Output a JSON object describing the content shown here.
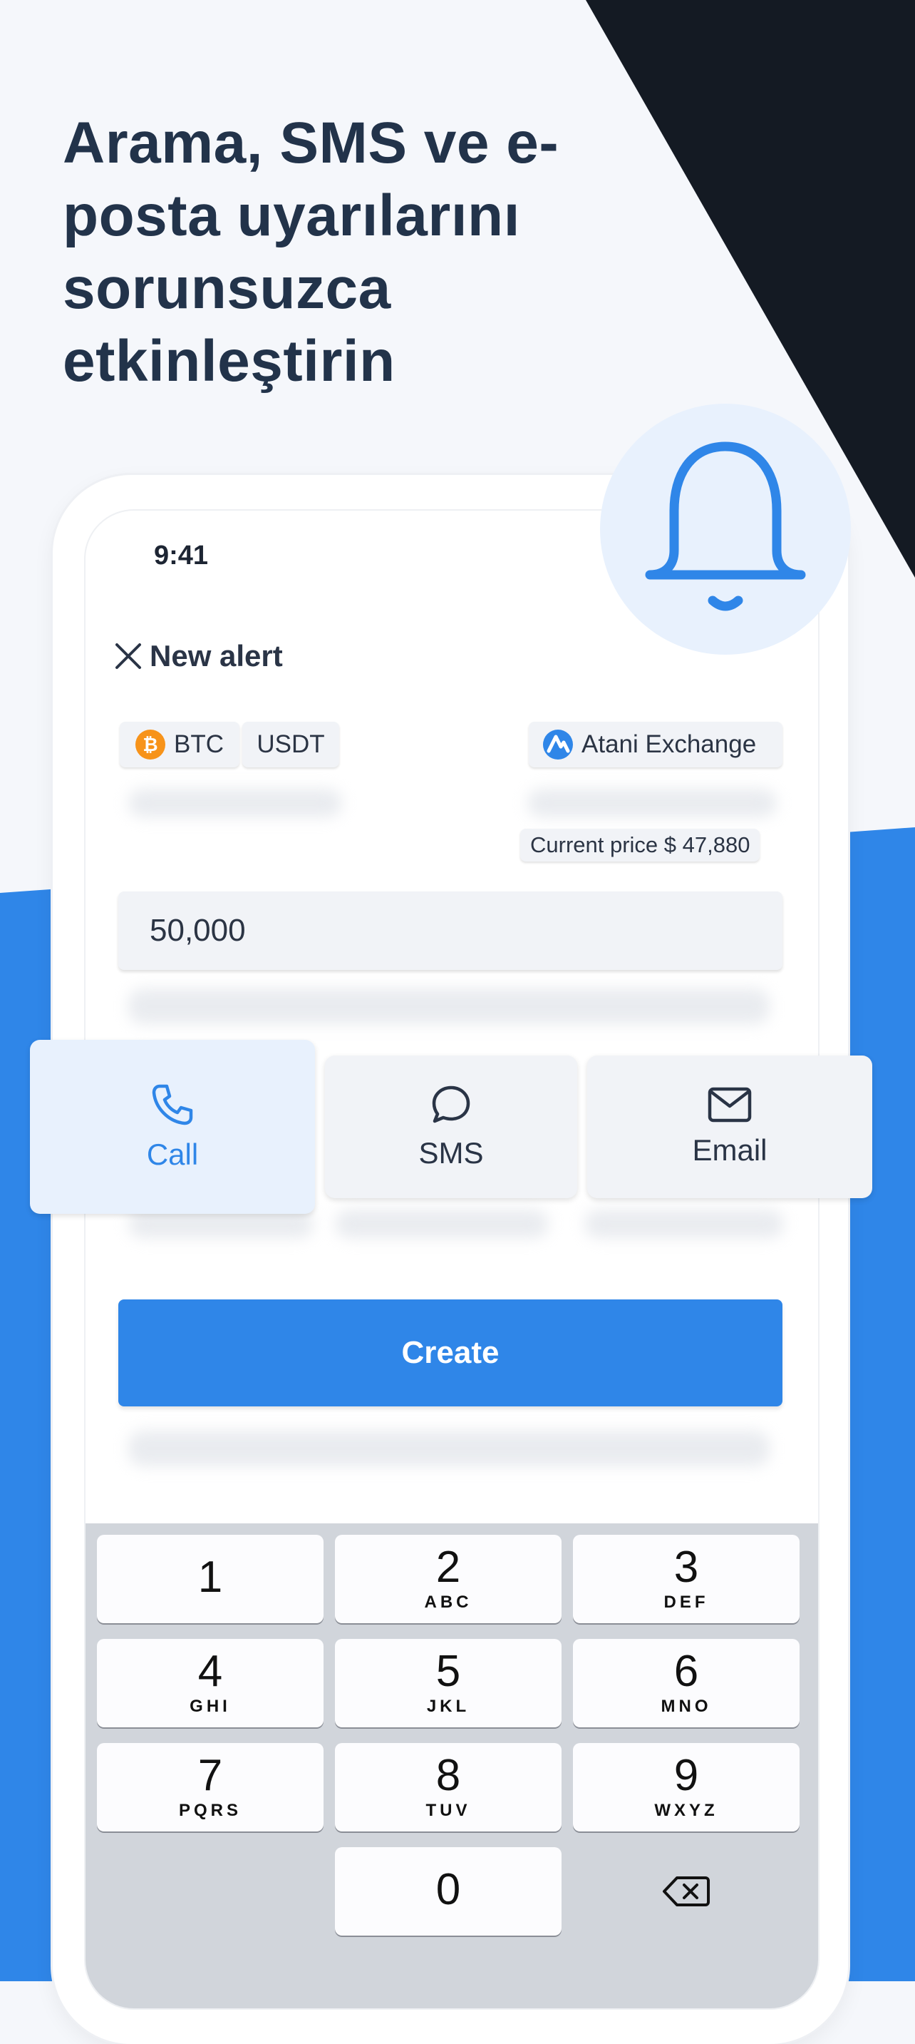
{
  "headline": "Arama, SMS ve e-posta uyarılarını sorunsuzca etkinleştirin",
  "status": {
    "time": "9:41"
  },
  "form": {
    "title": "New alert",
    "pair": {
      "base": "BTC",
      "quote": "USDT",
      "base_icon": "₿"
    },
    "exchange": "Atani Exchange",
    "current_price": "Current price $ 47,880",
    "price_value": "50,000",
    "create_label": "Create"
  },
  "channels": [
    {
      "label": "Call",
      "icon": "phone-icon",
      "active": true
    },
    {
      "label": "SMS",
      "icon": "chat-bubble-icon",
      "active": false
    },
    {
      "label": "Email",
      "icon": "envelope-icon",
      "active": false
    }
  ],
  "keypad": {
    "keys": [
      {
        "digit": "1",
        "letters": ""
      },
      {
        "digit": "2",
        "letters": "ABC"
      },
      {
        "digit": "3",
        "letters": "DEF"
      },
      {
        "digit": "4",
        "letters": "GHI"
      },
      {
        "digit": "5",
        "letters": "JKL"
      },
      {
        "digit": "6",
        "letters": "MNO"
      },
      {
        "digit": "7",
        "letters": "PQRS"
      },
      {
        "digit": "8",
        "letters": "TUV"
      },
      {
        "digit": "9",
        "letters": "WXYZ"
      },
      {
        "digit": "0",
        "letters": ""
      }
    ]
  },
  "colors": {
    "accent": "#2f86e8",
    "dark": "#141a23",
    "headline": "#22334a",
    "active_channel_bg": "#e8f1fd"
  }
}
